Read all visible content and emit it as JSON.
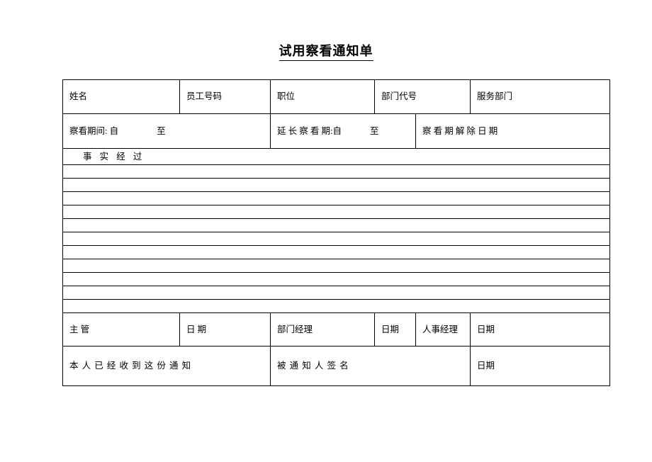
{
  "document": {
    "title": "试用察看通知单"
  },
  "table": {
    "row_identity": {
      "name_label": "姓名",
      "employee_no_label": "员工号码",
      "position_label": "职位",
      "dept_code_label": "部门代号",
      "service_dept_label": "服务部门"
    },
    "row_period": {
      "probation_period_label": "察看期间: 自",
      "probation_period_to": "至",
      "extended_period_label": "延 长 察 看 期:自",
      "extended_period_to": "至",
      "release_date_label": "察 看 期 解 除 日 期"
    },
    "row_facts": {
      "facts_label": "事 实 经 过"
    },
    "blank_lines_count": 11,
    "row_signature": {
      "supervisor_label": "主    管",
      "supervisor_date_label": "日  期",
      "dept_manager_label": "部门经理",
      "dept_manager_date_label": "日期",
      "hr_manager_label": "人事经理",
      "hr_manager_date_label": "日期"
    },
    "row_acknowledgement": {
      "acknowledgement_text": "本 人 已 经  收 到 这 份 通 知",
      "signature_label": "被 通 知 人 签  名",
      "date_label": "日期"
    }
  }
}
